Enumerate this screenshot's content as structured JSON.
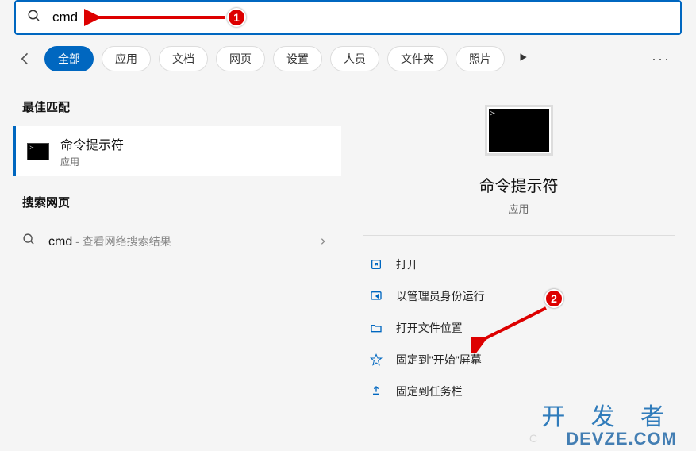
{
  "search": {
    "value": "cmd"
  },
  "filters": {
    "back": "←",
    "items": [
      "全部",
      "应用",
      "文档",
      "网页",
      "设置",
      "人员",
      "文件夹",
      "照片"
    ],
    "more": "···"
  },
  "left": {
    "bestMatchHeader": "最佳匹配",
    "bestMatch": {
      "title": "命令提示符",
      "subtitle": "应用"
    },
    "webHeader": "搜索网页",
    "webItem": {
      "term": "cmd",
      "desc": " - 查看网络搜索结果"
    }
  },
  "right": {
    "title": "命令提示符",
    "subtitle": "应用",
    "actions": [
      {
        "icon": "open",
        "label": "打开"
      },
      {
        "icon": "admin",
        "label": "以管理员身份运行"
      },
      {
        "icon": "folder",
        "label": "打开文件位置"
      },
      {
        "icon": "pin-start",
        "label": "固定到\"开始\"屏幕"
      },
      {
        "icon": "pin-task",
        "label": "固定到任务栏"
      }
    ]
  },
  "annotations": {
    "one": "1",
    "two": "2"
  },
  "watermark": {
    "line1": "开 发 者",
    "line2": "DEVZE.COM",
    "faint": "C"
  }
}
